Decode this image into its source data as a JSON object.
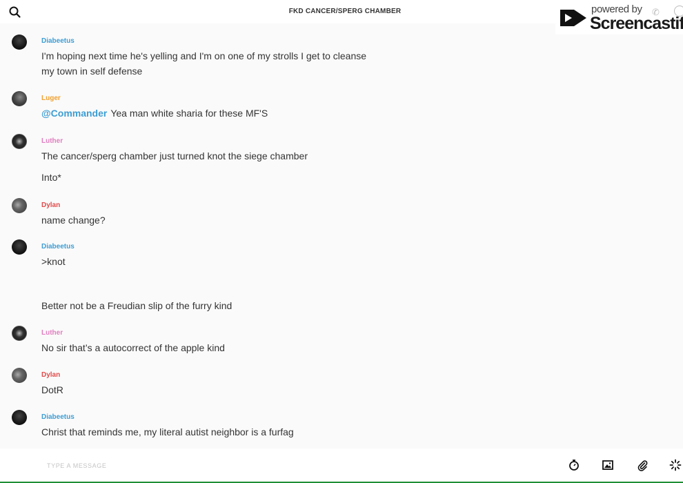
{
  "header": {
    "title": "FKD CANCER/SPERG CHAMBER",
    "search_icon": "search-icon"
  },
  "watermark": {
    "powered_by": "powered by",
    "brand": "Screencastify"
  },
  "messages": [
    {
      "author": "Diabeetus",
      "author_color": "#3d9dd3",
      "lines": [
        "I'm hoping next time he's yelling and I'm on one of my strolls I get to cleanse",
        "my town in self defense"
      ]
    },
    {
      "author": "Luger",
      "author_color": "#f0a030",
      "mention": "@Commander",
      "lines": [
        "Yea man white sharia for these MF'S"
      ]
    },
    {
      "author": "Luther",
      "author_color": "#e07fc0",
      "lines": [
        "The cancer/sperg chamber just turned knot the siege chamber",
        "Into*"
      ]
    },
    {
      "author": "Dylan",
      "author_color": "#e04b4b",
      "lines": [
        "name change?"
      ]
    },
    {
      "author": "Diabeetus",
      "author_color": "#3d9dd3",
      "lines": [
        ">knot",
        "Better not be a Freudian slip of the furry kind"
      ]
    },
    {
      "author": "Luther",
      "author_color": "#e07fc0",
      "lines": [
        "No sir that’s a autocorrect of the apple kind"
      ]
    },
    {
      "author": "Dylan",
      "author_color": "#e04b4b",
      "lines": [
        "DotR"
      ]
    },
    {
      "author": "Diabeetus",
      "author_color": "#3d9dd3",
      "lines": [
        "Christ that reminds me, my literal autist neighbor is a furfag"
      ]
    }
  ],
  "composer": {
    "placeholder": "TYPE A MESSAGE",
    "icons": [
      "timer-icon",
      "image-icon",
      "paperclip-icon",
      "sparkle-icon"
    ]
  }
}
